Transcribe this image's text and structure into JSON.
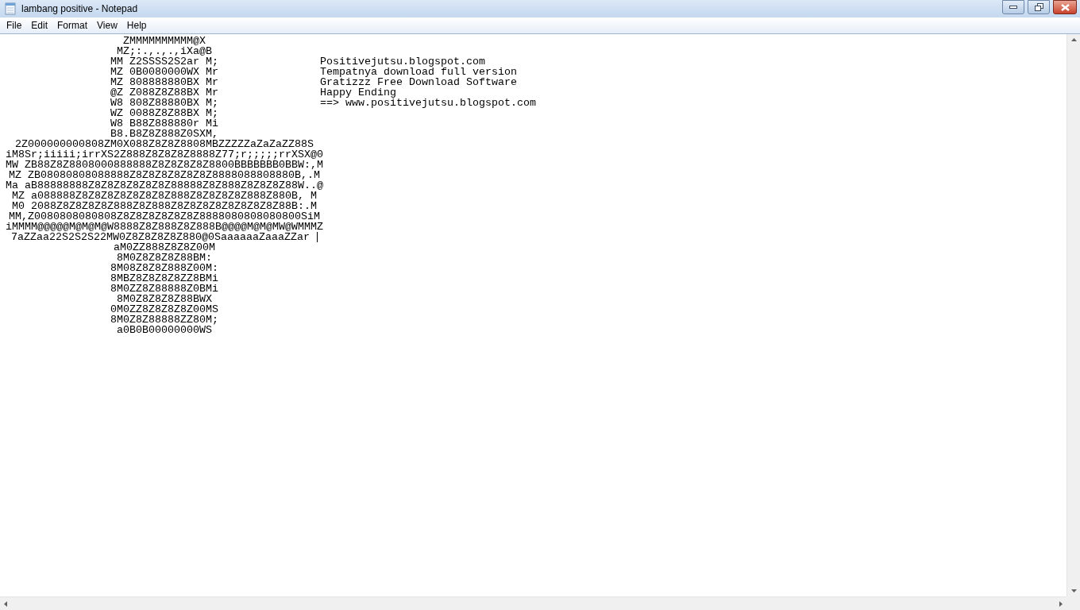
{
  "window": {
    "title": "lambang positive - Notepad"
  },
  "menu": [
    "File",
    "Edit",
    "Format",
    "View",
    "Help"
  ],
  "document": {
    "art_lines": [
      {
        "text": "ZMMMMMMMMMM@X",
        "caret": false
      },
      {
        "text": "MZ;:.,.,.,iXa@B",
        "caret": false
      },
      {
        "text": "MM Z2SSSS2S2ar M;",
        "caret": false
      },
      {
        "text": "MZ 0B0080000WX Mr",
        "caret": false
      },
      {
        "text": "MZ 808888880BX Mr",
        "caret": false
      },
      {
        "text": "@Z Z088Z8Z88BX Mr",
        "caret": false
      },
      {
        "text": "W8 808Z88880BX M;",
        "caret": false
      },
      {
        "text": "WZ 0088Z8Z88BX M;",
        "caret": false
      },
      {
        "text": "W8 B88Z888880r Mi",
        "caret": false
      },
      {
        "text": "B8.B8Z8Z888Z0SXM,",
        "caret": false
      },
      {
        "text": "2Z000000000808ZM0X088Z8Z8Z8808MBZZZZZaZaZaZZ88S",
        "caret": false
      },
      {
        "text": "iM8Sr;iiiii;irrXS2Z888Z8Z8Z8Z8888Z77;r;;;;;rrXSX@0",
        "caret": false
      },
      {
        "text": "MW ZB88Z8Z8808000888888Z8Z8Z8Z8Z8800BBBBBBB0BBW:,M",
        "caret": false
      },
      {
        "text": "MZ ZB08080808088888Z8Z8Z8Z8Z8Z8Z8888088808880B,.M",
        "caret": false
      },
      {
        "text": "Ma aB88888888Z8Z8Z8Z8Z8Z8Z88888Z8Z888Z8Z8Z8Z88W..@",
        "caret": false
      },
      {
        "text": "MZ a088888Z8Z8Z8Z8Z8Z8Z8Z888Z8Z8Z8Z8Z888Z880B, M",
        "caret": false
      },
      {
        "text": "M0 2088Z8Z8Z8Z8Z888Z8Z888Z8Z8Z8Z8Z8Z8Z8Z8Z88B:.M",
        "caret": false
      },
      {
        "text": "MM,Z0080808080808Z8Z8Z8Z8Z8Z8Z8888080808080800SiM",
        "caret": false
      },
      {
        "text": "iMMMM@@@@@M@M@M@W8888Z8Z888Z8Z888B@@@@M@M@MW@WMMMZ",
        "caret": false
      },
      {
        "text": "7aZZaa22S2S2S22MW0Z8Z8Z8Z8Z880@0SaaaaaaZaaaZZar",
        "caret": true
      },
      {
        "text": "aM0ZZ888Z8Z8Z00M",
        "caret": false
      },
      {
        "text": "8M0Z8Z8Z8Z88BM:",
        "caret": false
      },
      {
        "text": "8M08Z8Z8Z888Z00M:",
        "caret": false
      },
      {
        "text": "8MBZ8Z8Z8Z8ZZ8BMi",
        "caret": false
      },
      {
        "text": "8M0ZZ8Z88888Z0BMi",
        "caret": false
      },
      {
        "text": "8M0Z8Z8Z8Z88BWX",
        "caret": false
      },
      {
        "text": "0M0ZZ8Z8Z8Z8Z00MS",
        "caret": false
      },
      {
        "text": "8M0Z8Z88888ZZ80M;",
        "caret": false
      },
      {
        "text": "a0B0B00000000WS",
        "caret": false
      }
    ],
    "notes": [
      "Positivejutsu.blogspot.com",
      "Tempatnya download full version",
      "Gratizzz Free Download Software",
      "Happy Ending",
      "==> www.positivejutsu.blogspot.com"
    ]
  }
}
